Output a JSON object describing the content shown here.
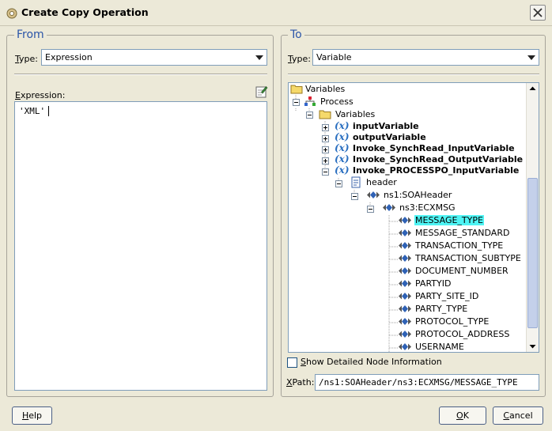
{
  "window": {
    "title": "Create Copy Operation",
    "close_icon": "close-icon"
  },
  "from": {
    "title": "From",
    "type_label": "Type:",
    "type_value": "Expression",
    "expression_label": "Expression:",
    "expression_value": "'XML'"
  },
  "to": {
    "title": "To",
    "type_label": "Type:",
    "type_value": "Variable",
    "tree": [
      {
        "label": "Variables",
        "icon": "folder-icon",
        "bold": false
      },
      {
        "label": "Process",
        "icon": "process-icon",
        "bold": false
      },
      {
        "label": "Variables",
        "icon": "folder-icon",
        "bold": false
      },
      {
        "label": "inputVariable",
        "icon": "variable-icon",
        "bold": true
      },
      {
        "label": "outputVariable",
        "icon": "variable-icon",
        "bold": true
      },
      {
        "label": "Invoke_SynchRead_InputVariable",
        "icon": "variable-icon",
        "bold": true
      },
      {
        "label": "Invoke_SynchRead_OutputVariable",
        "icon": "variable-icon",
        "bold": true
      },
      {
        "label": "Invoke_PROCESSPO_InputVariable",
        "icon": "variable-icon",
        "bold": true
      },
      {
        "label": "header",
        "icon": "message-part-icon",
        "bold": false
      },
      {
        "label": "ns1:SOAHeader",
        "icon": "element-icon",
        "bold": false
      },
      {
        "label": "ns3:ECXMSG",
        "icon": "element-icon",
        "bold": false
      },
      {
        "label": "MESSAGE_TYPE",
        "icon": "element-icon",
        "bold": false,
        "selected": true
      },
      {
        "label": "MESSAGE_STANDARD",
        "icon": "element-icon",
        "bold": false
      },
      {
        "label": "TRANSACTION_TYPE",
        "icon": "element-icon",
        "bold": false
      },
      {
        "label": "TRANSACTION_SUBTYPE",
        "icon": "element-icon",
        "bold": false
      },
      {
        "label": "DOCUMENT_NUMBER",
        "icon": "element-icon",
        "bold": false
      },
      {
        "label": "PARTYID",
        "icon": "element-icon",
        "bold": false
      },
      {
        "label": "PARTY_SITE_ID",
        "icon": "element-icon",
        "bold": false
      },
      {
        "label": "PARTY_TYPE",
        "icon": "element-icon",
        "bold": false
      },
      {
        "label": "PROTOCOL_TYPE",
        "icon": "element-icon",
        "bold": false
      },
      {
        "label": "PROTOCOL_ADDRESS",
        "icon": "element-icon",
        "bold": false
      },
      {
        "label": "USERNAME",
        "icon": "element-icon",
        "bold": false
      }
    ],
    "show_detail_label": "Show Detailed Node Information",
    "show_detail_checked": false,
    "xpath_label": "XPath:",
    "xpath_value": "/ns1:SOAHeader/ns3:ECXMSG/MESSAGE_TYPE"
  },
  "buttons": {
    "help": "Help",
    "ok": "OK",
    "cancel": "Cancel"
  },
  "colors": {
    "selection": "#4ef4f4",
    "panel_title": "#2b55a8",
    "dialog_bg": "#ece9d8"
  }
}
